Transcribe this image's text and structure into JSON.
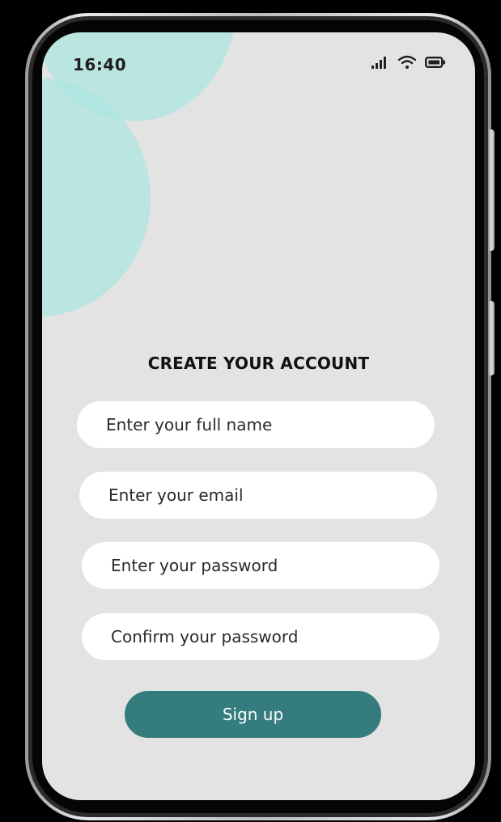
{
  "status_bar": {
    "time": "16:40",
    "icons": [
      "signal-icon",
      "wifi-icon",
      "battery-icon"
    ]
  },
  "form": {
    "title": "CREATE YOUR ACCOUNT",
    "fields": [
      {
        "placeholder": "Enter your full name",
        "value": ""
      },
      {
        "placeholder": "Enter your email",
        "value": ""
      },
      {
        "placeholder": "Enter your password",
        "value": ""
      },
      {
        "placeholder": "Confirm your password",
        "value": ""
      }
    ],
    "submit_label": "Sign up"
  },
  "colors": {
    "screen_background": "#e3e3e3",
    "accent_circles": "#aae6e1",
    "button": "#357c7e",
    "field_background": "#ffffff"
  }
}
